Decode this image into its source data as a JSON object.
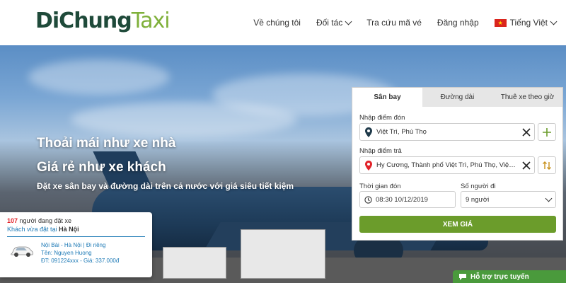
{
  "logo": {
    "part1": "DiChung",
    "part2": "Taxi"
  },
  "nav": {
    "about": "Về chúng tôi",
    "partners": "Đối tác",
    "lookup": "Tra cứu mã vé",
    "login": "Đăng nhập",
    "language": "Tiếng Việt"
  },
  "hero": {
    "line1": "Thoải mái như xe nhà",
    "line2": "Giá rẻ như xe khách",
    "line3": "Đặt xe sân bay và đường dài trên cả nước với giá siêu tiết kiệm"
  },
  "info_card": {
    "count": "107",
    "count_suffix": " người đang đặt xe",
    "recent_prefix": "Khách vừa đặt tại ",
    "recent_city": "Hà Nội",
    "route": "Nội Bài - Hà Nội | Đi riêng",
    "name": "Tên: Nguyen Huong",
    "phone_price": "ĐT: 091224xxx - Giá: 337.000đ"
  },
  "booking": {
    "tabs": [
      "Sân bay",
      "Đường dài",
      "Thuê xe theo giờ"
    ],
    "pickup_label": "Nhập điểm đón",
    "pickup_value": "Việt Trì, Phú Thọ",
    "dropoff_label": "Nhập điểm trả",
    "dropoff_value": "Hy Cương, Thành phố Việt Trì, Phú Thọ, Việt Nam",
    "time_label": "Thời gian đón",
    "time_value": "08:30 10/12/2019",
    "passengers_label": "Số người đi",
    "passengers_value": "9 người",
    "submit": "XEM GIÁ"
  },
  "support": {
    "label": "Hỗ trợ trực tuyến"
  },
  "colors": {
    "brand_dark": "#1f4a3a",
    "brand_green": "#7fb03a",
    "button_green": "#6b9c2b",
    "count_red": "#e2232a",
    "link_blue": "#1e7ab6"
  }
}
